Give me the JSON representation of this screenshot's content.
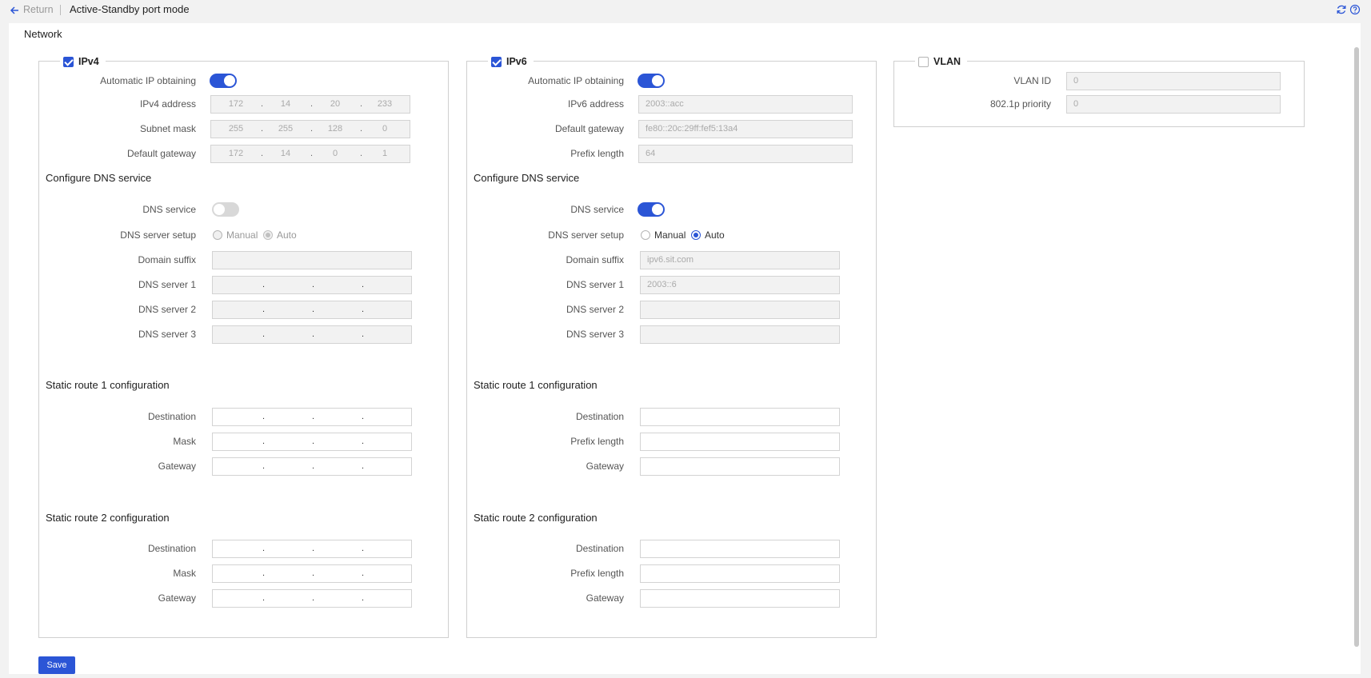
{
  "header": {
    "return_label": "Return",
    "title": "Active-Standby port mode"
  },
  "network_label": "Network",
  "ipv4": {
    "legend": "IPv4",
    "auto_ip_label": "Automatic IP obtaining",
    "address_label": "IPv4 address",
    "address": [
      "172",
      "14",
      "20",
      "233"
    ],
    "mask_label": "Subnet mask",
    "mask": [
      "255",
      "255",
      "128",
      "0"
    ],
    "gateway_label": "Default gateway",
    "gateway": [
      "172",
      "14",
      "0",
      "1"
    ],
    "dns_section": "Configure DNS service",
    "dns_service_label": "DNS service",
    "dns_setup_label": "DNS server setup",
    "manual": "Manual",
    "auto": "Auto",
    "domain_suffix_label": "Domain suffix",
    "dns1_label": "DNS server 1",
    "dns2_label": "DNS server 2",
    "dns3_label": "DNS server 3",
    "route1_section": "Static route 1 configuration",
    "route2_section": "Static route 2 configuration",
    "destination_label": "Destination",
    "mask_route_label": "Mask",
    "gateway_route_label": "Gateway"
  },
  "ipv6": {
    "legend": "IPv6",
    "auto_ip_label": "Automatic IP obtaining",
    "address_label": "IPv6 address",
    "address": "2003::acc",
    "gateway_label": "Default gateway",
    "gateway": "fe80::20c:29ff:fef5:13a4",
    "prefix_label": "Prefix length",
    "prefix": "64",
    "dns_section": "Configure DNS service",
    "dns_service_label": "DNS service",
    "dns_setup_label": "DNS server setup",
    "manual": "Manual",
    "auto": "Auto",
    "domain_suffix_label": "Domain suffix",
    "domain_suffix": "ipv6.sit.com",
    "dns1_label": "DNS server 1",
    "dns1": "2003::6",
    "dns2_label": "DNS server 2",
    "dns3_label": "DNS server 3",
    "route1_section": "Static route 1 configuration",
    "route2_section": "Static route 2 configuration",
    "destination_label": "Destination",
    "prefix_route_label": "Prefix length",
    "gateway_route_label": "Gateway"
  },
  "vlan": {
    "legend": "VLAN",
    "id_label": "VLAN ID",
    "id": "0",
    "priority_label": "802.1p priority",
    "priority": "0"
  },
  "save_label": "Save",
  "colors": {
    "accent": "#2b55d6"
  },
  "icons": {
    "back": "arrow-left-icon",
    "refresh": "refresh-icon",
    "help": "help-icon"
  }
}
